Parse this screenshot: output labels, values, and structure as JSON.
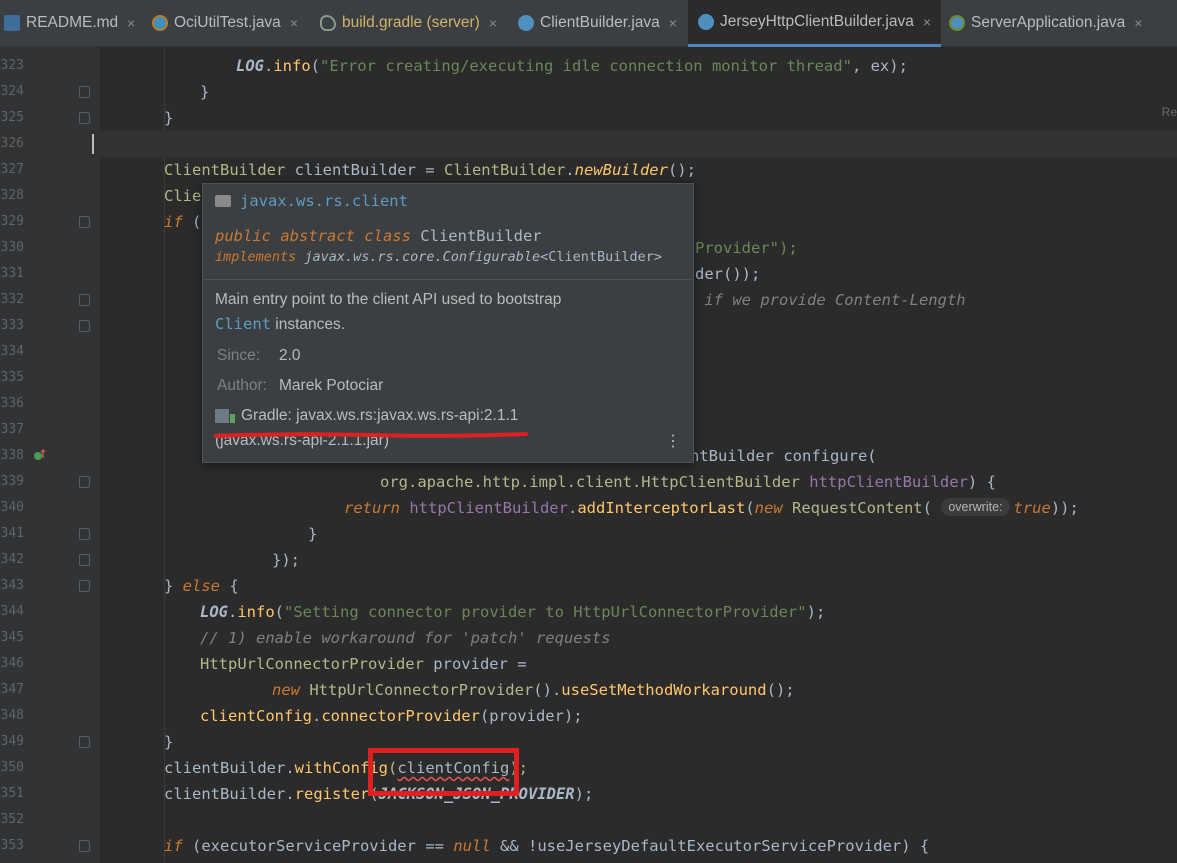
{
  "tabs": [
    {
      "label": "README.md",
      "icon": "markdown-file-icon"
    },
    {
      "label": "OciUtilTest.java",
      "icon": "java-test-class-icon"
    },
    {
      "label": "build.gradle (server)",
      "icon": "gradle-elephant-icon"
    },
    {
      "label": "ClientBuilder.java",
      "icon": "java-class-icon"
    },
    {
      "label": "JerseyHttpClientBuilder.java",
      "icon": "java-class-icon",
      "active": true
    },
    {
      "label": "ServerApplication.java",
      "icon": "spring-class-icon"
    }
  ],
  "close_glyph": "×",
  "right_gutter_text": "Re",
  "lines": [
    {
      "n": "323",
      "html_key": "l323"
    },
    {
      "n": "324"
    },
    {
      "n": "325"
    },
    {
      "n": "326"
    },
    {
      "n": "327"
    },
    {
      "n": "328"
    },
    {
      "n": "329"
    },
    {
      "n": "330"
    },
    {
      "n": "331"
    },
    {
      "n": "332"
    },
    {
      "n": "333"
    },
    {
      "n": "334"
    },
    {
      "n": "335"
    },
    {
      "n": "336"
    },
    {
      "n": "337"
    },
    {
      "n": "338"
    },
    {
      "n": "339"
    },
    {
      "n": "340"
    },
    {
      "n": "341"
    },
    {
      "n": "342"
    },
    {
      "n": "343"
    },
    {
      "n": "344"
    },
    {
      "n": "345"
    },
    {
      "n": "346"
    },
    {
      "n": "347"
    },
    {
      "n": "348"
    },
    {
      "n": "349"
    },
    {
      "n": "350"
    },
    {
      "n": "351"
    },
    {
      "n": "352"
    },
    {
      "n": "353"
    }
  ],
  "code": {
    "l323_log": "LOG",
    "l323_info": "info",
    "l323_str": "\"Error creating/executing idle connection monitor thread\"",
    "l323_rest": ", ex);",
    "l324": "}",
    "l325": "}",
    "l327_type": "ClientBuilder",
    "l327_var": " clientBuilder = ",
    "l327_cls": "ClientBuilder",
    "l327_dot": ".",
    "l327_m": "newBuilder",
    "l327_end": "();",
    "l328": "Clie",
    "l329_if": "if",
    "l329_rest": " (",
    "l330": "Provider\");",
    "l331": "der());",
    "l332": " if we provide Content-Length",
    "l338": "ntBuilder configure(",
    "l339_pkg": "org.apache.http.impl.client.HttpClientBuilder",
    "l339_p": " httpClientBuilder",
    "l339_end": ") {",
    "l340_ret": "return",
    "l340_v": " httpClientBuilder",
    "l340_dot": ".",
    "l340_m": "addInterceptorLast",
    "l340_p": "(",
    "l340_new": "new",
    "l340_cls": " RequestContent",
    "l340_p2": "(",
    "l340_hint": "overwrite:",
    "l340_true": "true",
    "l340_end": "));",
    "l341": "}",
    "l342": "});",
    "l343_a": "} ",
    "l343_else": "else",
    "l343_b": " {",
    "l344_log": "LOG",
    "l344_info": "info",
    "l344_str": "\"Setting connector provider to HttpUrlConnectorProvider\"",
    "l344_end": ");",
    "l345": "// 1) enable workaround for 'patch' requests",
    "l346_type": "HttpUrlConnectorProvider",
    "l346_rest": " provider =",
    "l347_new": "new",
    "l347_cls": " HttpUrlConnectorProvider",
    "l347_mid": "().",
    "l347_m": "useSetMethodWorkaround",
    "l347_end": "();",
    "l348_v": "clientConfig",
    "l348_dot": ".",
    "l348_m": "connectorProvider",
    "l348_end": "(provider);",
    "l349": "}",
    "l350_v": "clientBuilder",
    "l350_dot": ".",
    "l350_m": "withConfig",
    "l350_p": "(",
    "l350_arg": "clientConfig",
    "l350_end": ");",
    "l351_v": "clientBuilder",
    "l351_dot": ".",
    "l351_m": "register",
    "l351_p": "(",
    "l351_f": "JACKSON_JSON_PROVIDER",
    "l351_end": ");",
    "l353_if": "if",
    "l353_a": " (executorServiceProvider ",
    "l353_eq": "==",
    "l353_b": " ",
    "l353_null": "null",
    "l353_c": " && !useJerseyDefaultExecutorServiceProvider) {"
  },
  "popup": {
    "package": "javax.ws.rs.client",
    "sig_mod": "public abstract class",
    "sig_name": " ClientBuilder",
    "sig_impl": "implements",
    "sig_iface": " javax.ws.rs.core.Configurable",
    "sig_generic": "<ClientBuilder>",
    "desc_before": "Main entry point to the client API used to bootstrap ",
    "desc_link": "Client",
    "desc_after": " instances.",
    "since_label": "Since:",
    "since_value": "2.0",
    "author_label": "Author:",
    "author_value": "Marek Potociar",
    "gradle_text": "Gradle: javax.ws.rs:javax.ws.rs-api:2.1.1",
    "jar_text": "(javax.ws.rs-api-2.1.1.jar)",
    "more_glyph": "⋮"
  },
  "annotation_colors": {
    "underline": "#e02020",
    "box": "#e02020"
  }
}
